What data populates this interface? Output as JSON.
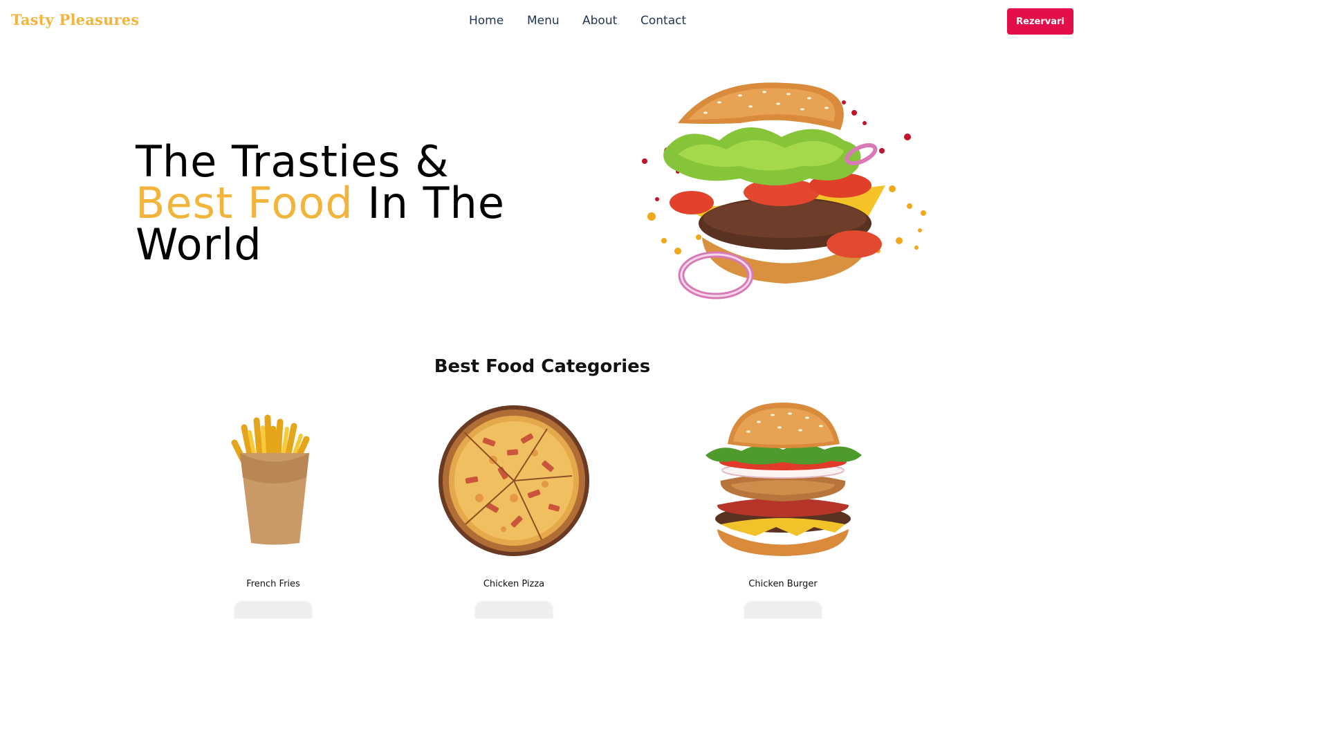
{
  "brand": {
    "name": "Tasty Pleasures",
    "color": "#f2b43a"
  },
  "nav": {
    "items": [
      {
        "label": "Home"
      },
      {
        "label": "Menu"
      },
      {
        "label": "About"
      },
      {
        "label": "Contact"
      }
    ],
    "cta_label": "Rezervari",
    "cta_color": "#e20f4b"
  },
  "hero": {
    "line1": "The Trasties &",
    "accent": "Best Food",
    "line2_rest": " In The",
    "line3": "World",
    "image_icon": "burger-image"
  },
  "categories": {
    "title": "Best Food Categories",
    "items": [
      {
        "name": "French Fries",
        "icon": "french-fries-image"
      },
      {
        "name": "Chicken Pizza",
        "icon": "pizza-image"
      },
      {
        "name": "Chicken Burger",
        "icon": "burger-image"
      }
    ]
  }
}
